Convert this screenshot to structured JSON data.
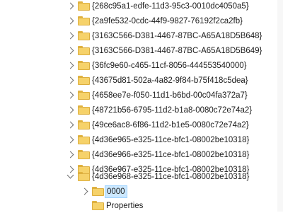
{
  "registry_tree": {
    "keys": [
      "{268c95a1-edfe-11d3-95c3-0010dc4050a5}",
      "{2a9fe532-0cdc-44f9-9827-76192f2ca2fb}",
      "{3163C566-D381-4467-87BC-A65A18D5B648}",
      "{3163C566-D381-4467-87BC-A65A18D5B649}",
      "{36fc9e60-c465-11cf-8056-444553540000}",
      "{43675d81-502a-4a82-9f84-b75f418c5dea}",
      "{4658ee7e-f050-11d1-b6bd-00c04fa372a7}",
      "{48721b56-6795-11d2-b1a8-0080c72e74a2}",
      "{49ce6ac8-6f86-11d2-b1e5-0080c72e74a2}",
      "{4d36e965-e325-11ce-bfc1-08002be10318}",
      "{4d36e966-e325-11ce-bfc1-08002be10318}",
      "{4d36e967-e325-11ce-bfc1-08002be10318}",
      "{4d36e968-e325-11ce-bfc1-08002be10318}"
    ],
    "subkeys": [
      "0000",
      "Properties"
    ],
    "selected": "0000"
  },
  "colors": {
    "folder_fill": "#f6d26a",
    "folder_border": "#dcae3f",
    "selection_fill": "#cce8ff",
    "selection_border": "#99d1ff"
  }
}
